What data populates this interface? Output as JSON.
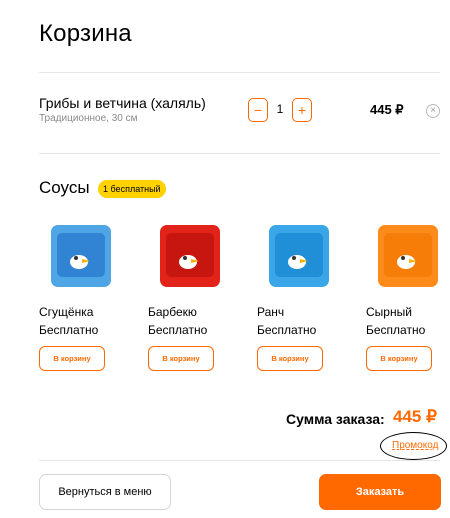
{
  "page_title": "Корзина",
  "cart_item": {
    "name": "Грибы и ветчина (халяль)",
    "details": "Традиционное, 30 см",
    "minus_label": "−",
    "quantity": "1",
    "plus_label": "+",
    "price": "445 ₽",
    "remove_label": "×"
  },
  "sauces": {
    "title": "Соусы",
    "badge": "1 бесплатный",
    "items": [
      {
        "name": "Сгущёнка",
        "price": "Бесплатно",
        "button": "В корзину",
        "color": "#4fa6e6",
        "lid_color": "#2d7fd0"
      },
      {
        "name": "Барбекю",
        "price": "Бесплатно",
        "button": "В корзину",
        "color": "#e2231a",
        "lid_color": "#c4150f"
      },
      {
        "name": "Ранч",
        "price": "Бесплатно",
        "button": "В корзину",
        "color": "#3aa6e8",
        "lid_color": "#1f8cd6"
      },
      {
        "name": "Сырный",
        "price": "Бесплатно",
        "button": "В корзину",
        "color": "#ff8c1a",
        "lid_color": "#f47b07"
      }
    ]
  },
  "summary": {
    "label": "Сумма заказа:",
    "total": "445 ₽",
    "promo": "Промокод"
  },
  "actions": {
    "back": "Вернуться в меню",
    "order": "Заказать"
  },
  "colors": {
    "accent": "#ff6900",
    "badge": "#ffd200"
  }
}
